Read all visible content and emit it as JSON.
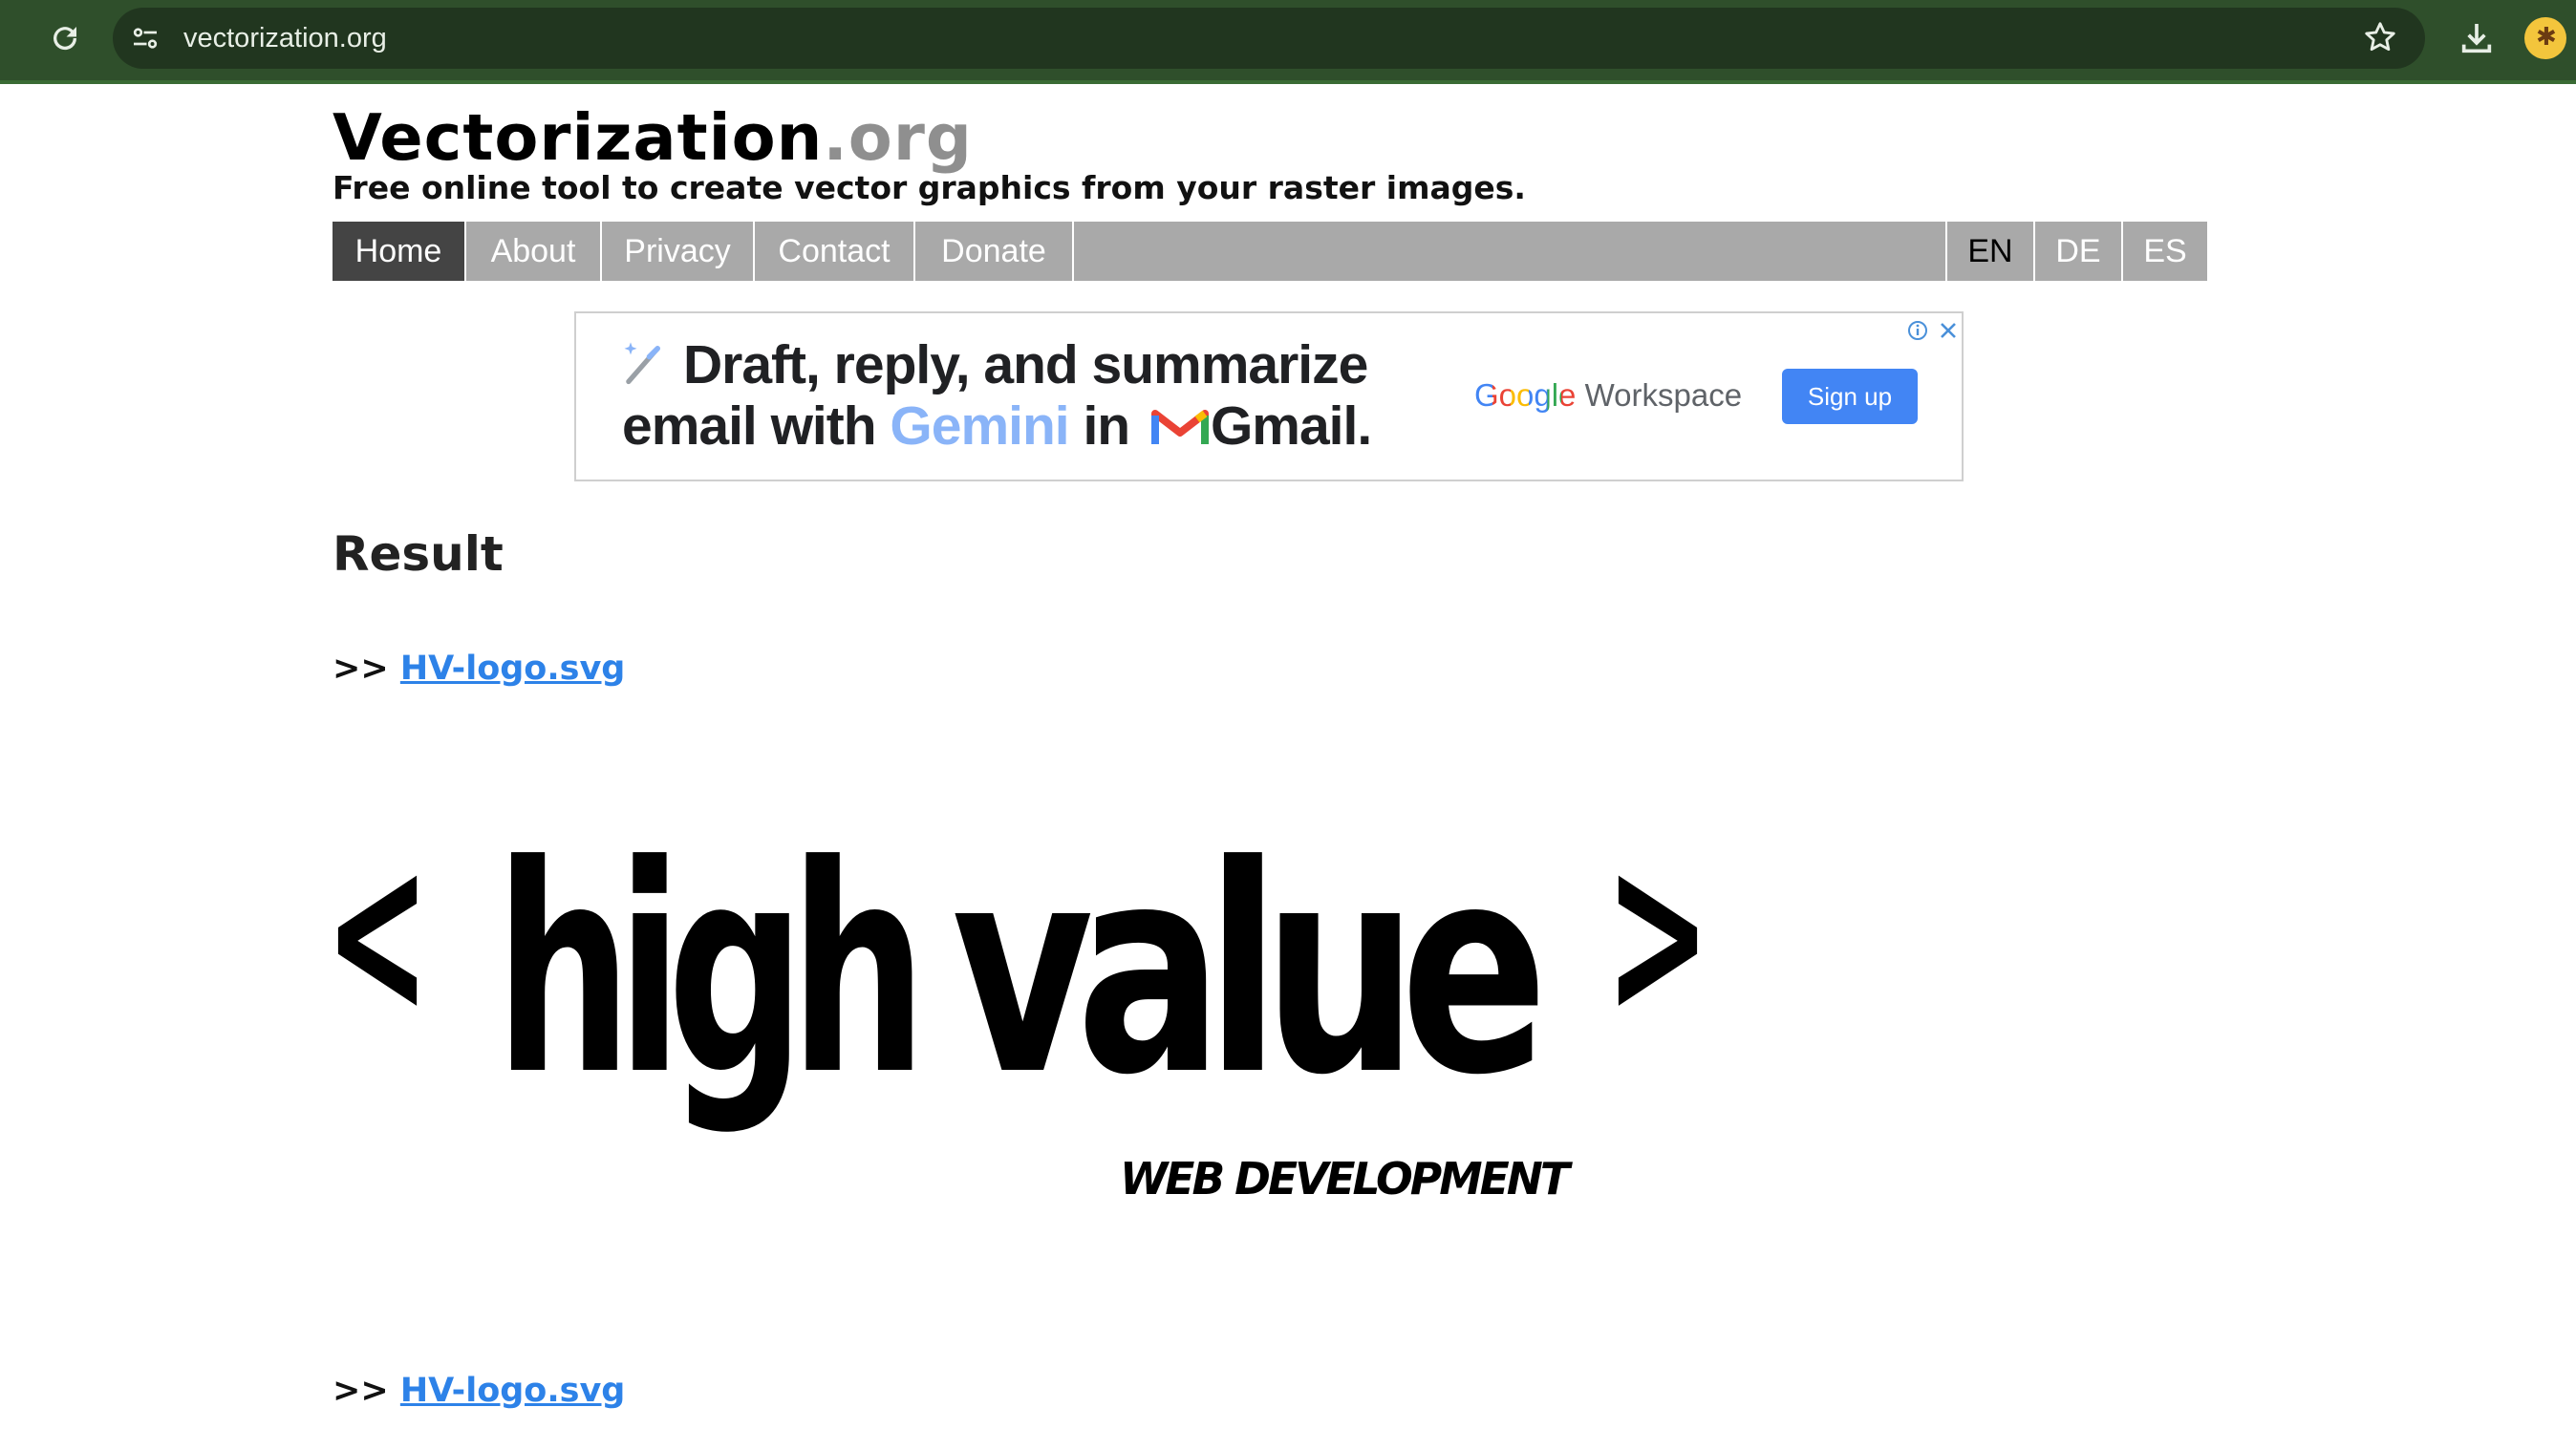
{
  "browser": {
    "url": "vectorization.org"
  },
  "site": {
    "name": "Vectorization",
    "tld": ".org",
    "tagline": "Free online tool to create vector graphics from your raster images."
  },
  "nav": {
    "items": [
      "Home",
      "About",
      "Privacy",
      "Contact",
      "Donate"
    ],
    "active": "Home",
    "languages": [
      "EN",
      "DE",
      "ES"
    ],
    "active_language": "EN"
  },
  "ad": {
    "line1": "Draft, reply, and summarize",
    "line2_a": "email with ",
    "line2_gemini": "Gemini",
    "line2_b": " in ",
    "line2_gmail": "Gmail.",
    "brand": "Google",
    "brand_product": " Workspace",
    "cta": "Sign up"
  },
  "main": {
    "heading": "Result",
    "prefix": ">>",
    "file_link": "HV-logo.svg",
    "logo_text": {
      "left_bracket": "<",
      "word1": "high",
      "word2": "value",
      "right_bracket": ">",
      "subtitle": "WEB  DEVELOPMENT"
    }
  },
  "colors": {
    "chrome_bg": "#2f4f2b",
    "nav_bg": "#a9a9a9",
    "nav_active_bg": "#444444",
    "link": "#2d82e8",
    "ad_button": "#4285f4"
  }
}
